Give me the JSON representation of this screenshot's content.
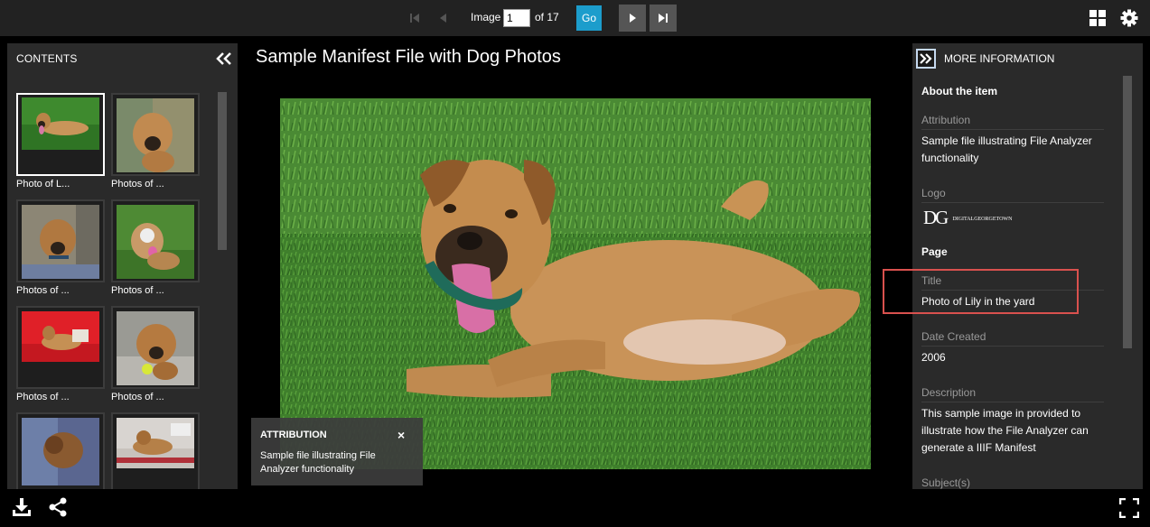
{
  "toolbar": {
    "image_label": "Image",
    "current_page": "1",
    "total_label": "of 17",
    "go_label": "Go"
  },
  "contents": {
    "title": "CONTENTS",
    "thumbnails": [
      {
        "label": "Photo of L..."
      },
      {
        "label": "Photos of ..."
      },
      {
        "label": "Photos of ..."
      },
      {
        "label": "Photos of ..."
      },
      {
        "label": "Photos of ..."
      },
      {
        "label": "Photos of ..."
      },
      {
        "label": ""
      },
      {
        "label": ""
      }
    ]
  },
  "main": {
    "title": "Sample Manifest File with Dog Photos"
  },
  "attribution_popup": {
    "title": "ATTRIBUTION",
    "close": "×",
    "text": "Sample file illustrating File Analyzer functionality"
  },
  "more_info": {
    "title": "MORE INFORMATION",
    "about_heading": "About the item",
    "attribution_label": "Attribution",
    "attribution_value": "Sample file illustrating File Analyzer functionality",
    "logo_label": "Logo",
    "logo_text": "DIGITALGEORGETOWN",
    "logo_mark": "DG",
    "page_heading": "Page",
    "title_label": "Title",
    "title_value": "Photo of Lily in the yard",
    "date_label": "Date Created",
    "date_value": "2006",
    "description_label": "Description",
    "description_value": "This sample image in provided to illustrate how the File Analyzer can generate a IIIF Manifest",
    "subject_label": "Subject(s)"
  },
  "colors": {
    "toolbar_bg": "#222222",
    "panel_bg": "#2a2a2a",
    "go_button": "#1c9dcc",
    "highlight": "#d9514e"
  }
}
